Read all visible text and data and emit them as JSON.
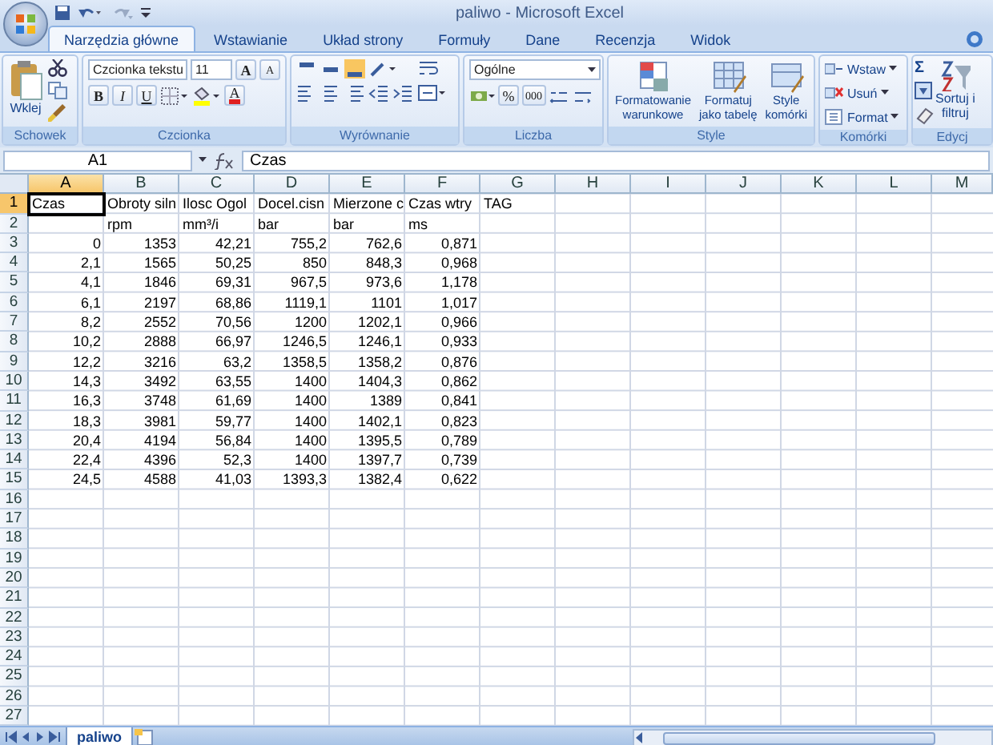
{
  "window": {
    "title": "paliwo - Microsoft Excel"
  },
  "tabs": [
    {
      "label": "Narzędzia główne",
      "selected": true
    },
    {
      "label": "Wstawianie",
      "selected": false
    },
    {
      "label": "Układ strony",
      "selected": false
    },
    {
      "label": "Formuły",
      "selected": false
    },
    {
      "label": "Dane",
      "selected": false
    },
    {
      "label": "Recenzja",
      "selected": false
    },
    {
      "label": "Widok",
      "selected": false
    }
  ],
  "ribbon": [
    {
      "kind": "clipboard",
      "label": "Schowek",
      "paste": "Wklej"
    },
    {
      "kind": "font",
      "label": "Czcionka",
      "font_name": "Czcionka tekstu",
      "font_size": "11",
      "grow": "A",
      "shrink": "A",
      "bold": "B",
      "italic": "I",
      "underline": "U",
      "font_color_letter": "A"
    },
    {
      "kind": "alignment",
      "label": "Wyrównanie"
    },
    {
      "kind": "number",
      "label": "Liczba",
      "format": "Ogólne",
      "percent": "%",
      "thousands": "000"
    },
    {
      "kind": "styles",
      "label": "Style",
      "buttons": [
        {
          "lines": [
            "Formatowanie",
            "warunkowe"
          ]
        },
        {
          "lines": [
            "Formatuj",
            "jako tabelę"
          ]
        },
        {
          "lines": [
            "Style",
            "komórki"
          ]
        }
      ]
    },
    {
      "kind": "cells",
      "label": "Komórki",
      "buttons": [
        "Wstaw",
        "Usuń",
        "Format"
      ]
    },
    {
      "kind": "editing",
      "label": "Edycj",
      "sum": "Σ",
      "sort": [
        "Sortuj i",
        "filtruj"
      ]
    }
  ],
  "formula_bar": {
    "name_box": "A1",
    "value": "Czas"
  },
  "columns": [
    {
      "label": "A",
      "selected": true
    },
    {
      "label": "B",
      "selected": false
    },
    {
      "label": "C",
      "selected": false
    },
    {
      "label": "D",
      "selected": false
    },
    {
      "label": "E",
      "selected": false
    },
    {
      "label": "F",
      "selected": false
    },
    {
      "label": "G",
      "selected": false
    },
    {
      "label": "H",
      "selected": false
    },
    {
      "label": "I",
      "selected": false
    },
    {
      "label": "J",
      "selected": false
    },
    {
      "label": "K",
      "selected": false
    },
    {
      "label": "L",
      "selected": false
    },
    {
      "label": "M",
      "selected": false
    }
  ],
  "rows": [
    {
      "header": "1",
      "selected": true,
      "kind": "text",
      "cells": [
        "Czas",
        "Obroty siln",
        "Ilosc  Ogol",
        "Docel.cisn",
        "Mierzone c",
        "Czas wtry",
        "TAG"
      ]
    },
    {
      "header": "2",
      "selected": false,
      "kind": "text",
      "cells": [
        "",
        "rpm",
        "mm³/i",
        "bar",
        "bar",
        "ms"
      ]
    },
    {
      "header": "3",
      "selected": false,
      "kind": "number",
      "cells": [
        "0",
        "1353",
        "42,21",
        "755,2",
        "762,6",
        "0,871"
      ]
    },
    {
      "header": "4",
      "selected": false,
      "kind": "number",
      "cells": [
        "2,1",
        "1565",
        "50,25",
        "850",
        "848,3",
        "0,968"
      ]
    },
    {
      "header": "5",
      "selected": false,
      "kind": "number",
      "cells": [
        "4,1",
        "1846",
        "69,31",
        "967,5",
        "973,6",
        "1,178"
      ]
    },
    {
      "header": "6",
      "selected": false,
      "kind": "number",
      "cells": [
        "6,1",
        "2197",
        "68,86",
        "1119,1",
        "1101",
        "1,017"
      ]
    },
    {
      "header": "7",
      "selected": false,
      "kind": "number",
      "cells": [
        "8,2",
        "2552",
        "70,56",
        "1200",
        "1202,1",
        "0,966"
      ]
    },
    {
      "header": "8",
      "selected": false,
      "kind": "number",
      "cells": [
        "10,2",
        "2888",
        "66,97",
        "1246,5",
        "1246,1",
        "0,933"
      ]
    },
    {
      "header": "9",
      "selected": false,
      "kind": "number",
      "cells": [
        "12,2",
        "3216",
        "63,2",
        "1358,5",
        "1358,2",
        "0,876"
      ]
    },
    {
      "header": "10",
      "selected": false,
      "kind": "number",
      "cells": [
        "14,3",
        "3492",
        "63,55",
        "1400",
        "1404,3",
        "0,862"
      ]
    },
    {
      "header": "11",
      "selected": false,
      "kind": "number",
      "cells": [
        "16,3",
        "3748",
        "61,69",
        "1400",
        "1389",
        "0,841"
      ]
    },
    {
      "header": "12",
      "selected": false,
      "kind": "number",
      "cells": [
        "18,3",
        "3981",
        "59,77",
        "1400",
        "1402,1",
        "0,823"
      ]
    },
    {
      "header": "13",
      "selected": false,
      "kind": "number",
      "cells": [
        "20,4",
        "4194",
        "56,84",
        "1400",
        "1395,5",
        "0,789"
      ]
    },
    {
      "header": "14",
      "selected": false,
      "kind": "number",
      "cells": [
        "22,4",
        "4396",
        "52,3",
        "1400",
        "1397,7",
        "0,739"
      ]
    },
    {
      "header": "15",
      "selected": false,
      "kind": "number",
      "cells": [
        "24,5",
        "4588",
        "41,03",
        "1393,3",
        "1382,4",
        "0,622"
      ]
    },
    {
      "header": "16",
      "selected": false,
      "kind": "text",
      "cells": []
    },
    {
      "header": "17",
      "selected": false,
      "kind": "text",
      "cells": []
    },
    {
      "header": "18",
      "selected": false,
      "kind": "text",
      "cells": []
    },
    {
      "header": "19",
      "selected": false,
      "kind": "text",
      "cells": []
    },
    {
      "header": "20",
      "selected": false,
      "kind": "text",
      "cells": []
    },
    {
      "header": "21",
      "selected": false,
      "kind": "text",
      "cells": []
    },
    {
      "header": "22",
      "selected": false,
      "kind": "text",
      "cells": []
    },
    {
      "header": "23",
      "selected": false,
      "kind": "text",
      "cells": []
    },
    {
      "header": "24",
      "selected": false,
      "kind": "text",
      "cells": []
    },
    {
      "header": "25",
      "selected": false,
      "kind": "text",
      "cells": []
    },
    {
      "header": "26",
      "selected": false,
      "kind": "text",
      "cells": []
    },
    {
      "header": "27",
      "selected": false,
      "kind": "text",
      "cells": []
    }
  ],
  "sheet_tabs": [
    {
      "label": "paliwo",
      "selected": true
    }
  ]
}
